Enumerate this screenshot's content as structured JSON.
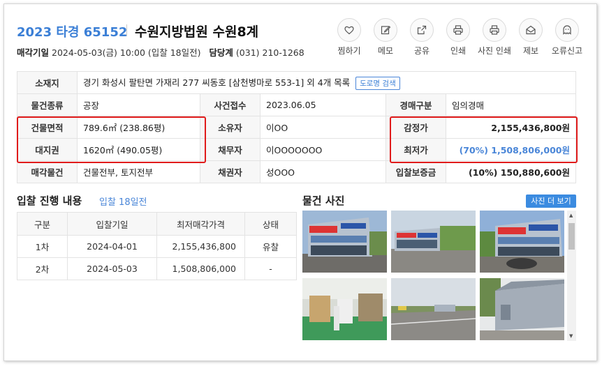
{
  "header": {
    "case_no": "2023 타경 65152",
    "court": "수원지방법원 수원8계",
    "sale_date_label": "매각기일",
    "sale_date_value": "2024-05-03(금) 10:00 (입찰 18일전)",
    "manager_label": "담당계",
    "manager_value": "(031) 210-1268"
  },
  "actions": [
    {
      "label": "찜하기",
      "icon": "heart-icon"
    },
    {
      "label": "메모",
      "icon": "memo-icon"
    },
    {
      "label": "공유",
      "icon": "share-icon"
    },
    {
      "label": "인쇄",
      "icon": "print-icon"
    },
    {
      "label": "사진 인쇄",
      "icon": "photo-print-icon"
    },
    {
      "label": "제보",
      "icon": "report-icon"
    },
    {
      "label": "오류신고",
      "icon": "error-report-icon"
    }
  ],
  "info": {
    "location_label": "소재지",
    "location_value": "경기 화성시 팔탄면 가재리 277 씨동호 [삼천병마로 553-1] 외 4개 목록",
    "road_btn": "도로명 검색",
    "type_label": "물건종류",
    "type_value": "공장",
    "case_receipt_label": "사건접수",
    "case_receipt_value": "2023.06.05",
    "auction_type_label": "경매구분",
    "auction_type_value": "임의경매",
    "building_area_label": "건물면적",
    "building_area_value": "789.6㎡ (238.86평)",
    "owner_label": "소유자",
    "owner_value": "이OO",
    "appraisal_label": "감정가",
    "appraisal_value": "2,155,436,800원",
    "land_label": "대지권",
    "land_value": "1620㎡ (490.05평)",
    "debtor_label": "채무자",
    "debtor_value": "이OOOOOOO",
    "min_price_label": "최저가",
    "min_price_value": "(70%) 1,508,806,000원",
    "sale_item_label": "매각물건",
    "sale_item_value": "건물전부, 토지전부",
    "creditor_label": "채권자",
    "creditor_value": "성OOO",
    "deposit_label": "입찰보증금",
    "deposit_value": "(10%) 150,880,600원"
  },
  "bid_section": {
    "title": "입찰 진행 내용",
    "subtitle": "입찰 18일전",
    "headers": [
      "구분",
      "입찰기일",
      "최저매각가격",
      "상태"
    ],
    "rows": [
      [
        "1차",
        "2024-04-01",
        "2,155,436,800",
        "유찰"
      ],
      [
        "2차",
        "2024-05-03",
        "1,508,806,000",
        "-"
      ]
    ]
  },
  "photo_section": {
    "title": "물건 사진",
    "more_btn": "사진 더 보기"
  },
  "colors": {
    "accent": "#3b7fd6",
    "highlight": "#e01b1b"
  }
}
